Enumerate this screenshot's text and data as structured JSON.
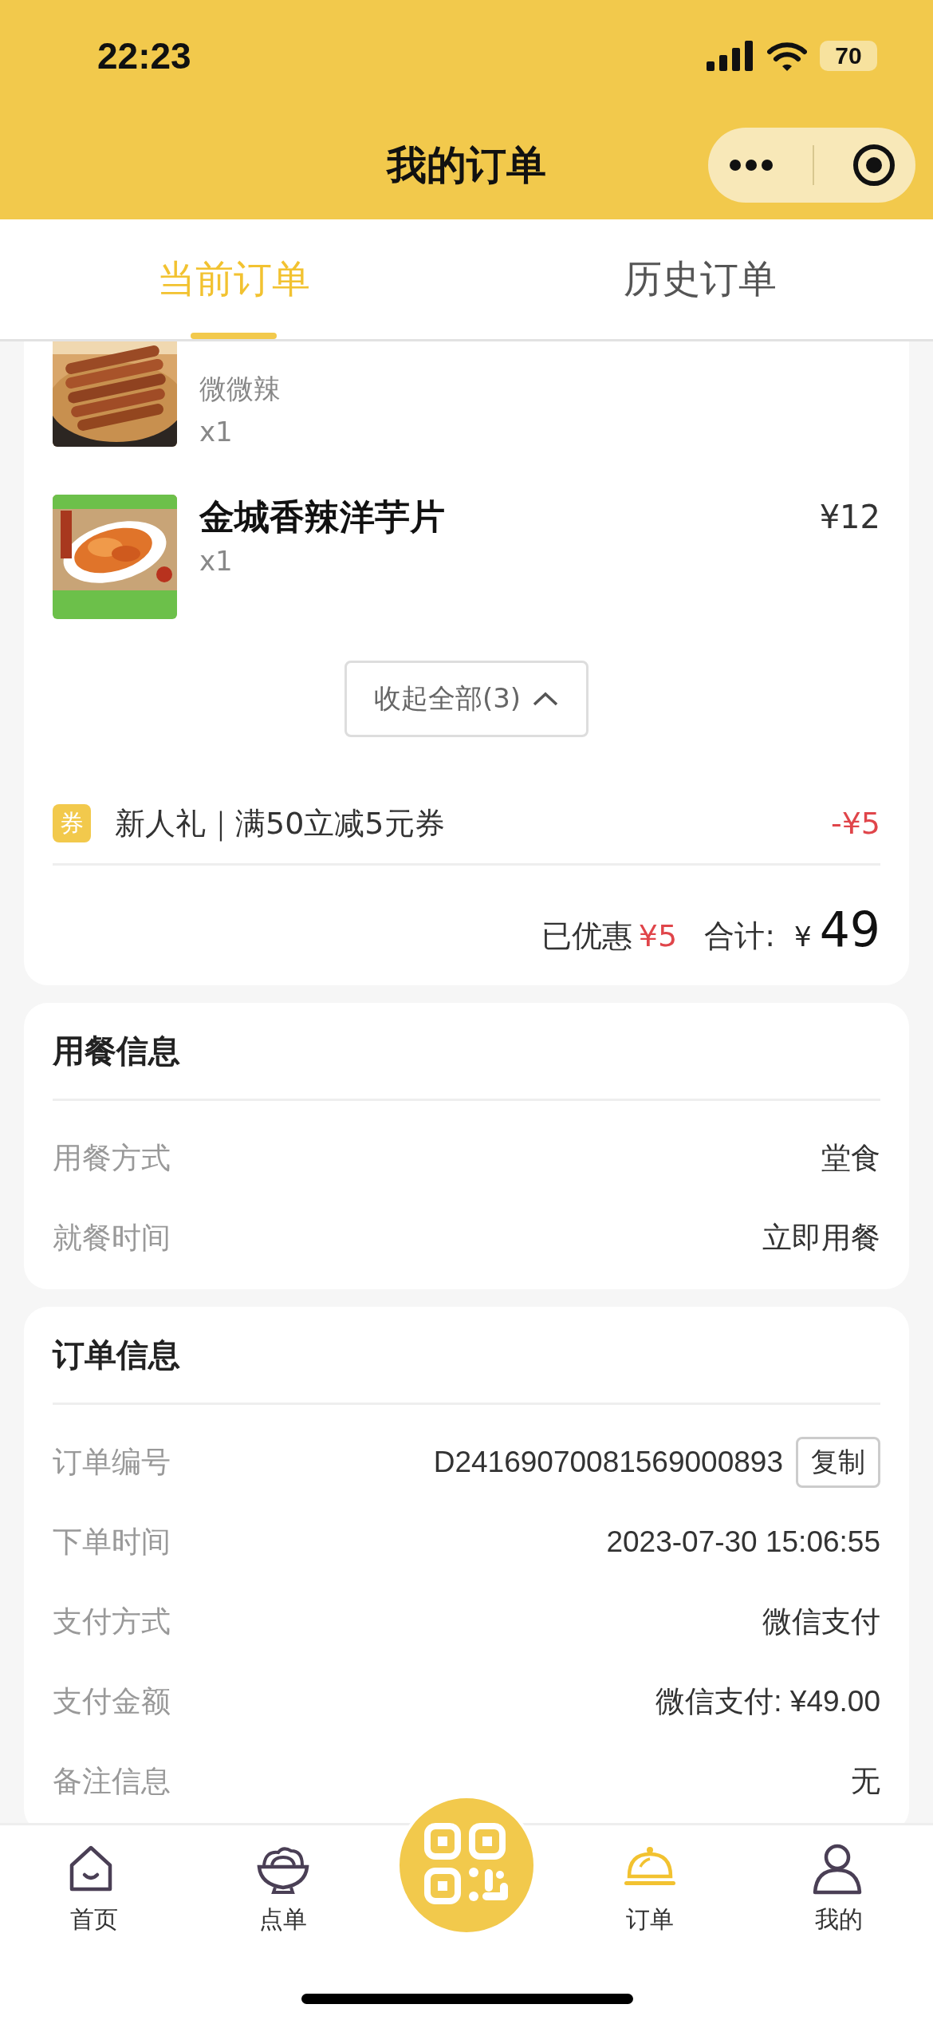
{
  "status_bar": {
    "time": "22:23",
    "battery": "70"
  },
  "nav": {
    "title": "我的订单"
  },
  "tabs": [
    {
      "label": "当前订单",
      "selected": true
    },
    {
      "label": "历史订单",
      "selected": false
    }
  ],
  "order_items": [
    {
      "kind": "skewer",
      "option": "微微辣",
      "quantity": "x1"
    },
    {
      "kind": "chips",
      "name": "金城香辣洋芋片",
      "quantity": "x1",
      "price": "¥12"
    }
  ],
  "collapse_button": "收起全部(3)",
  "coupon": {
    "badge": "券",
    "label": "新人礼｜满50立减5元券",
    "amount": "-¥5"
  },
  "summary": {
    "discount_label": "已优惠",
    "discount": "¥5",
    "total_label": "合计:",
    "currency": "¥",
    "total": "49"
  },
  "sections": [
    {
      "title": "用餐信息",
      "rows": [
        {
          "label": "用餐方式",
          "value": "堂食"
        },
        {
          "label": "就餐时间",
          "value": "立即用餐"
        }
      ]
    },
    {
      "title": "订单信息",
      "rows": [
        {
          "label": "订单编号",
          "value": "D24169070081569000893",
          "action": "复制"
        },
        {
          "label": "下单时间",
          "value": "2023-07-30 15:06:55"
        },
        {
          "label": "支付方式",
          "value": "微信支付"
        },
        {
          "label": "支付金额",
          "value": "微信支付: ¥49.00"
        },
        {
          "label": "备注信息",
          "value": "无"
        }
      ]
    }
  ],
  "bottom_nav": [
    {
      "kind": "home",
      "label": "首页",
      "selected": false
    },
    {
      "kind": "bowl",
      "label": "点单",
      "selected": false
    },
    {
      "kind": "scan"
    },
    {
      "kind": "cloche",
      "label": "订单",
      "selected": true
    },
    {
      "kind": "person",
      "label": "我的",
      "selected": false
    }
  ]
}
